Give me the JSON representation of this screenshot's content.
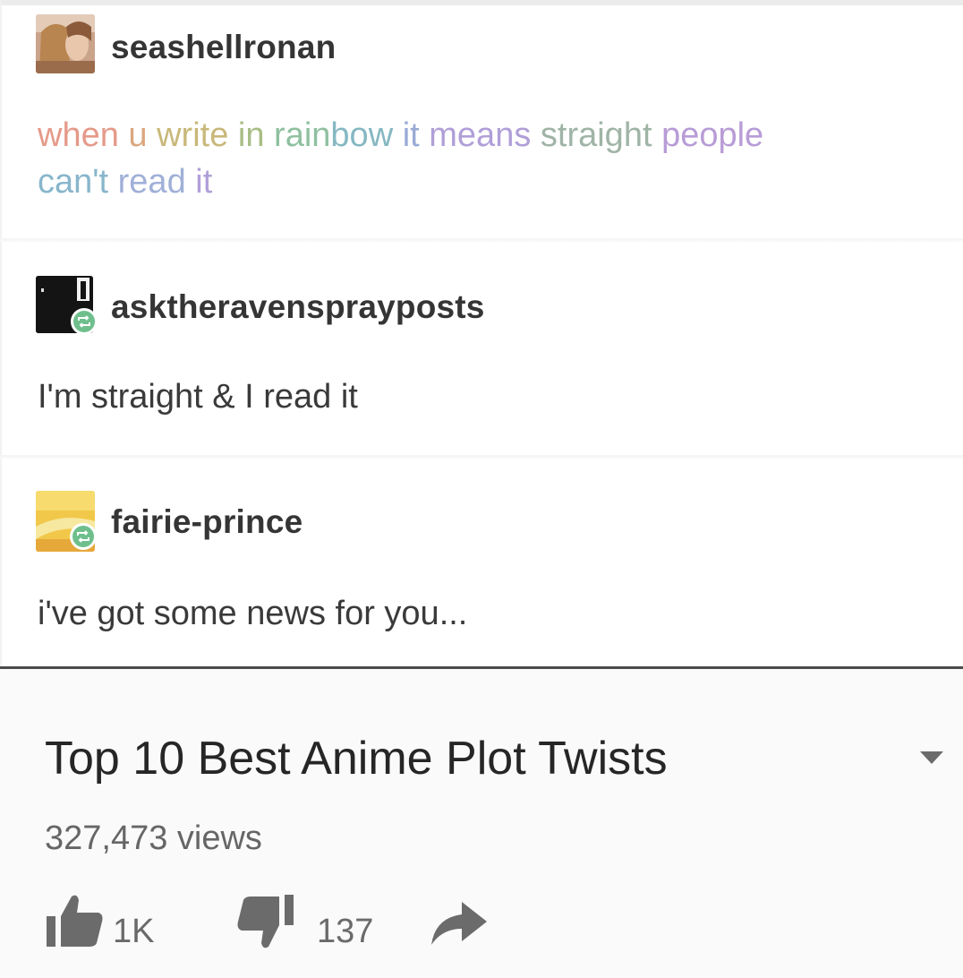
{
  "posts": [
    {
      "username": "seashellronan",
      "rainbow_lines": [
        [
          {
            "t": "when ",
            "c": "#e59a8a"
          },
          {
            "t": "u ",
            "c": "#dba77f"
          },
          {
            "t": "write ",
            "c": "#c9b87a"
          },
          {
            "t": "in ",
            "c": "#a8bd85"
          },
          {
            "t": "rain",
            "c": "#8fc0a0"
          },
          {
            "t": "bow ",
            "c": "#86b8c2"
          },
          {
            "t": "it ",
            "c": "#9aaad6"
          },
          {
            "t": "means ",
            "c": "#b09fd8"
          },
          {
            "t": "straight ",
            "c": "#9fb4a6"
          },
          {
            "t": "people",
            "c": "#b89cd6"
          }
        ],
        [
          {
            "t": "can't ",
            "c": "#88b6cc"
          },
          {
            "t": "read ",
            "c": "#a0b0d8"
          },
          {
            "t": "it",
            "c": "#b0a0d8"
          }
        ]
      ]
    },
    {
      "username": "asktheravensprayposts",
      "text": "I'm straight & I read it"
    },
    {
      "username": "fairie-prince",
      "text": "i've got some news for you..."
    }
  ],
  "video": {
    "title": "Top 10 Best Anime Plot Twists",
    "views": "327,473 views",
    "likes": "1K",
    "dislikes": "137"
  },
  "icons": {
    "reblog": "reblog-icon",
    "like": "thumbs-up-icon",
    "dislike": "thumbs-down-icon",
    "share": "share-arrow-icon",
    "dropdown": "chevron-down-icon"
  },
  "colors": {
    "reblog_badge": "#6fbf8d",
    "divider": "#4b4b4b"
  }
}
